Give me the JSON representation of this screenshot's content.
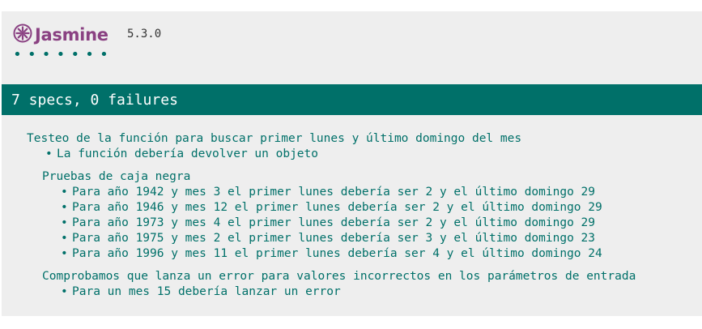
{
  "banner": {
    "logo_text": "Jasmine",
    "version": "5.3.0"
  },
  "dots": "•••••••",
  "summary": {
    "text": "7 specs, 0 failures"
  },
  "colors": {
    "brand": "#8a4182",
    "passed": "#007069",
    "background": "#eeeeee"
  },
  "suite": {
    "title": "Testeo de la función para buscar primer lunes y último domingo del mes",
    "specs": [
      "La función debería devolver un objeto"
    ],
    "subsuites": [
      {
        "title": "Pruebas de caja negra",
        "specs": [
          "Para año 1942 y mes 3 el primer lunes debería ser 2 y el último domingo 29",
          "Para año 1946 y mes 12 el primer lunes debería ser 2 y el último domingo 29",
          "Para año 1973 y mes 4 el primer lunes debería ser 2 y el último domingo 29",
          "Para año 1975 y mes 2 el primer lunes debería ser 3 y el último domingo 23",
          "Para año 1996 y mes 11 el primer lunes debería ser 4 y el último domingo 24"
        ]
      },
      {
        "title": "Comprobamos que lanza un error para valores incorrectos en los parámetros de entrada",
        "specs": [
          "Para un mes 15 debería lanzar un error"
        ]
      }
    ]
  }
}
